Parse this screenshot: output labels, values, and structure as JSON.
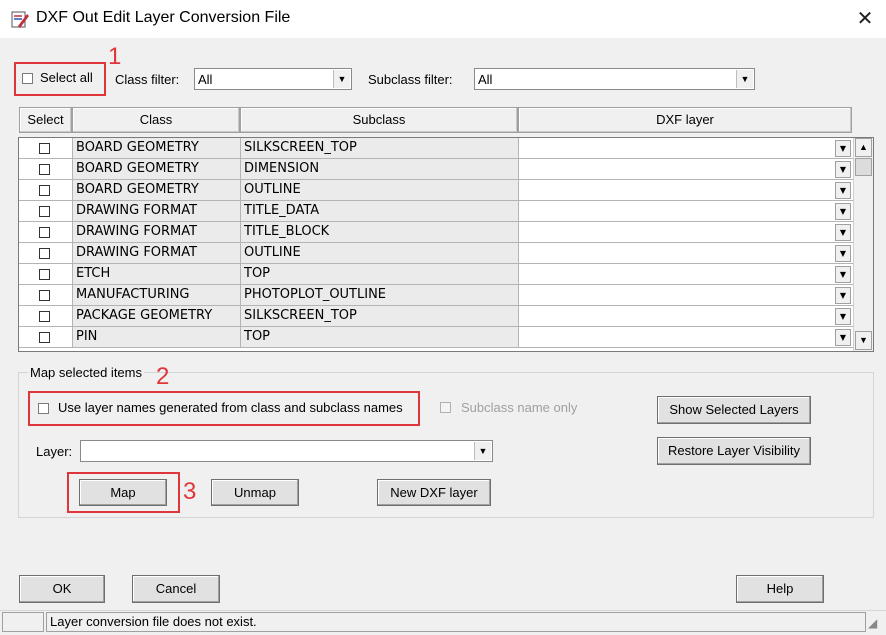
{
  "window": {
    "title": "DXF Out Edit Layer Conversion File",
    "close_glyph": "✕"
  },
  "filters": {
    "select_all_label": "Select all",
    "class_filter_label": "Class filter:",
    "class_filter_value": "All",
    "subclass_filter_label": "Subclass filter:",
    "subclass_filter_value": "All"
  },
  "annotations": {
    "one": "1",
    "two": "2",
    "three": "3",
    "color": "#e0353a"
  },
  "table": {
    "headers": [
      "Select",
      "Class",
      "Subclass",
      "DXF layer"
    ],
    "rows": [
      {
        "class": "BOARD GEOMETRY",
        "subclass": "SILKSCREEN_TOP",
        "dxf_layer": ""
      },
      {
        "class": "BOARD GEOMETRY",
        "subclass": "DIMENSION",
        "dxf_layer": ""
      },
      {
        "class": "BOARD GEOMETRY",
        "subclass": "OUTLINE",
        "dxf_layer": ""
      },
      {
        "class": "DRAWING FORMAT",
        "subclass": "TITLE_DATA",
        "dxf_layer": ""
      },
      {
        "class": "DRAWING FORMAT",
        "subclass": "TITLE_BLOCK",
        "dxf_layer": ""
      },
      {
        "class": "DRAWING FORMAT",
        "subclass": "OUTLINE",
        "dxf_layer": ""
      },
      {
        "class": "ETCH",
        "subclass": "TOP",
        "dxf_layer": ""
      },
      {
        "class": "MANUFACTURING",
        "subclass": "PHOTOPLOT_OUTLINE",
        "dxf_layer": ""
      },
      {
        "class": "PACKAGE GEOMETRY",
        "subclass": "SILKSCREEN_TOP",
        "dxf_layer": ""
      },
      {
        "class": "PIN",
        "subclass": "TOP",
        "dxf_layer": ""
      }
    ]
  },
  "map_group": {
    "legend": "Map selected items",
    "use_layer_names_label": "Use layer names generated from class and subclass names",
    "subclass_only_label": "Subclass name only",
    "layer_label": "Layer:",
    "layer_value": "",
    "map_button": "Map",
    "unmap_button": "Unmap",
    "new_dxf_layer_button": "New DXF layer",
    "show_selected_button": "Show Selected Layers",
    "restore_visibility_button": "Restore Layer Visibility"
  },
  "footer": {
    "ok": "OK",
    "cancel": "Cancel",
    "help": "Help"
  },
  "status": {
    "text": "Layer conversion file does not exist."
  }
}
